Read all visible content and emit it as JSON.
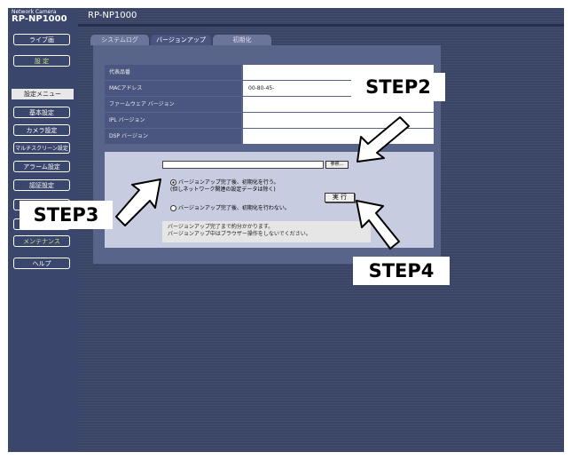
{
  "brand": {
    "top_label": "Network Camera",
    "model": "RP-NP1000"
  },
  "header": {
    "title": "RP-NP1000"
  },
  "sidebar": {
    "live_button": "ライブ画",
    "settings_button": "設 定",
    "menu_header": "設定メニュー",
    "items": [
      {
        "label": "基本設定"
      },
      {
        "label": "カメラ設定"
      },
      {
        "label": "マルチスクリーン設定"
      },
      {
        "label": "アラーム設定"
      },
      {
        "label": "認証設定"
      },
      {
        "label": "メンテナンス"
      }
    ],
    "help_button": "ヘルプ"
  },
  "tabs": [
    {
      "label": "システムログ"
    },
    {
      "label": "バージョンアップ"
    },
    {
      "label": "初期化"
    }
  ],
  "info_rows": [
    {
      "label": "代表品番",
      "value": ""
    },
    {
      "label": "MACアドレス",
      "value": "00-80-45-"
    },
    {
      "label": "ファームウェア バージョン",
      "value": ""
    },
    {
      "label": "IPL バージョン",
      "value": ""
    },
    {
      "label": "DSP バージョン",
      "value": ""
    }
  ],
  "update": {
    "browse_label": "参照...",
    "option1_line1": "バージョンアップ完了後、初期化を行う。",
    "option1_line2": "(但しネットワーク関連の設定データは除く)",
    "option2": "バージョンアップ完了後、初期化を行わない。",
    "execute_label": "実 行",
    "note_line1": "バージョンアップ完了まで約分かかります。",
    "note_line2": "バージョンアップ中はブラウザー操作をしないでください。"
  },
  "callouts": {
    "step2": "STEP2",
    "step3": "STEP3",
    "step4": "STEP4"
  }
}
